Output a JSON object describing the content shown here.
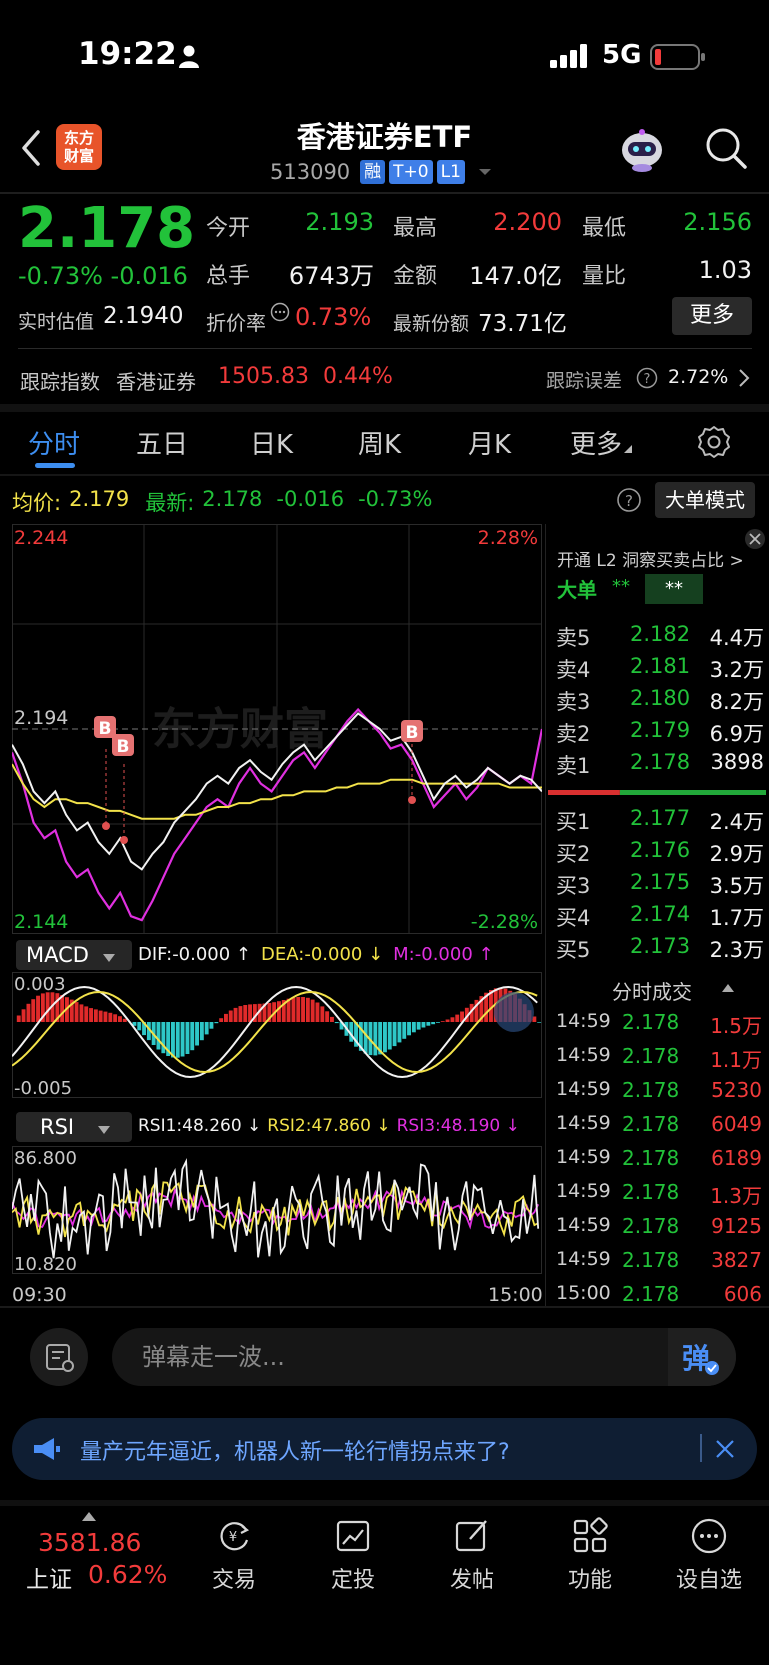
{
  "status": {
    "time": "19:22",
    "network": "5G"
  },
  "header": {
    "title": "香港证券ETF",
    "code": "513090",
    "tags": [
      "融",
      "T+0",
      "L1"
    ],
    "logo_line1": "东方",
    "logo_line2": "财富"
  },
  "quote": {
    "price": "2.178",
    "change_pct": "-0.73%",
    "change": "-0.016",
    "open_label": "今开",
    "open": "2.193",
    "high_label": "最高",
    "high": "2.200",
    "low_label": "最低",
    "low": "2.156",
    "volume_label": "总手",
    "volume": "6743万",
    "amount_label": "金额",
    "amount": "147.0亿",
    "ratio_label": "量比",
    "ratio": "1.03",
    "rt_label": "实时估值",
    "rt_value": "2.1940",
    "discount_label": "折价率",
    "discount": "0.73%",
    "share_label": "最新份额",
    "share": "73.71亿",
    "more_label": "更多"
  },
  "tracking": {
    "label": "跟踪指数",
    "index": "香港证券",
    "value": "1505.83",
    "pct": "0.44%",
    "err_label": "跟踪误差",
    "err": "2.72%"
  },
  "tabs": [
    "分时",
    "五日",
    "日K",
    "周K",
    "月K",
    "更多"
  ],
  "avg_row": {
    "avg_label": "均价:",
    "avg": "2.179",
    "last_label": "最新:",
    "last": "2.178",
    "chg": "-0.016",
    "pct": "-0.73%",
    "bigorder_btn": "大单模式"
  },
  "chart_data": [
    {
      "type": "line",
      "title": "",
      "ylim": [
        2.144,
        2.244
      ],
      "y_ticks": [
        "2.244",
        "2.194",
        "2.144"
      ],
      "pct_ticks": [
        "2.28%",
        "-2.28%"
      ],
      "x_ticks": [
        "09:30",
        "15:00"
      ],
      "series": [
        {
          "values": [
            2.19,
            2.185,
            2.178,
            2.175,
            2.178,
            2.172,
            2.168,
            2.17,
            2.165,
            2.162,
            2.166,
            2.16,
            2.158,
            2.162,
            2.165,
            2.17,
            2.173,
            2.176,
            2.18,
            2.182,
            2.18,
            2.184,
            2.186,
            2.183,
            2.181,
            2.185,
            2.188,
            2.19,
            2.186,
            2.189,
            2.192,
            2.195,
            2.198,
            2.196,
            2.194,
            2.191,
            2.192,
            2.188,
            2.182,
            2.176,
            2.18,
            2.182,
            2.179,
            2.181,
            2.184,
            2.182,
            2.18,
            2.182,
            2.181,
            2.178
          ]
        },
        {
          "values": [
            2.185,
            2.18,
            2.176,
            2.174,
            2.176,
            2.176,
            2.175,
            2.175,
            2.174,
            2.173,
            2.173,
            2.172,
            2.171,
            2.171,
            2.171,
            2.171,
            2.172,
            2.172,
            2.173,
            2.174,
            2.174,
            2.175,
            2.175,
            2.176,
            2.176,
            2.177,
            2.177,
            2.178,
            2.178,
            2.178,
            2.179,
            2.179,
            2.18,
            2.18,
            2.18,
            2.181,
            2.181,
            2.181,
            2.18,
            2.18,
            2.18,
            2.18,
            2.18,
            2.18,
            2.18,
            2.18,
            2.179,
            2.179,
            2.179,
            2.179
          ]
        },
        {
          "values": [
            2.188,
            2.18,
            2.17,
            2.166,
            2.168,
            2.16,
            2.156,
            2.158,
            2.152,
            2.148,
            2.152,
            2.146,
            2.145,
            2.15,
            2.156,
            2.162,
            2.166,
            2.17,
            2.174,
            2.176,
            2.174,
            2.18,
            2.184,
            2.18,
            2.178,
            2.182,
            2.186,
            2.188,
            2.184,
            2.188,
            2.192,
            2.196,
            2.199,
            2.196,
            2.193,
            2.189,
            2.19,
            2.186,
            2.18,
            2.174,
            2.177,
            2.18,
            2.176,
            2.179,
            2.184,
            2.182,
            2.18,
            2.182,
            2.18,
            2.194
          ]
        }
      ]
    },
    {
      "type": "bar",
      "title": "MACD",
      "ylim": [
        -0.005,
        0.003
      ],
      "y_ticks": [
        "0.003",
        "-0.005"
      ],
      "labels": {
        "dif": "DIF:-0.000 ↑",
        "dea": "DEA:-0.000 ↓",
        "m": "M:-0.000 ↑"
      }
    },
    {
      "type": "line",
      "title": "RSI",
      "ylim": [
        10.82,
        86.8
      ],
      "y_ticks": [
        "86.800",
        "10.820"
      ],
      "labels": {
        "rsi1": "RSI1:48.260 ↓",
        "rsi2": "RSI2:47.860 ↓",
        "rsi3": "RSI3:48.190 ↓"
      }
    }
  ],
  "l2": {
    "label": "开通 L2 洞察买卖占比 >",
    "big": "大单",
    "mask_a": "**",
    "mask_b": "**"
  },
  "orderbook": {
    "asks": [
      {
        "label": "卖5",
        "price": "2.182",
        "vol": "4.4万"
      },
      {
        "label": "卖4",
        "price": "2.181",
        "vol": "3.2万"
      },
      {
        "label": "卖3",
        "price": "2.180",
        "vol": "8.2万"
      },
      {
        "label": "卖2",
        "price": "2.179",
        "vol": "6.9万"
      },
      {
        "label": "卖1",
        "price": "2.178",
        "vol": "3898"
      }
    ],
    "bids": [
      {
        "label": "买1",
        "price": "2.177",
        "vol": "2.4万"
      },
      {
        "label": "买2",
        "price": "2.176",
        "vol": "2.9万"
      },
      {
        "label": "买3",
        "price": "2.175",
        "vol": "3.5万"
      },
      {
        "label": "买4",
        "price": "2.174",
        "vol": "1.7万"
      },
      {
        "label": "买5",
        "price": "2.173",
        "vol": "2.3万"
      }
    ],
    "ask_ratio": 0.33
  },
  "ticks": {
    "title": "分时成交",
    "rows": [
      {
        "time": "14:59",
        "price": "2.178",
        "vol": "1.5万"
      },
      {
        "time": "14:59",
        "price": "2.178",
        "vol": "1.1万"
      },
      {
        "time": "14:59",
        "price": "2.178",
        "vol": "5230"
      },
      {
        "time": "14:59",
        "price": "2.178",
        "vol": "6049"
      },
      {
        "time": "14:59",
        "price": "2.178",
        "vol": "6189"
      },
      {
        "time": "14:59",
        "price": "2.178",
        "vol": "1.3万"
      },
      {
        "time": "14:59",
        "price": "2.178",
        "vol": "9125"
      },
      {
        "time": "14:59",
        "price": "2.178",
        "vol": "3827"
      },
      {
        "time": "15:00",
        "price": "2.178",
        "vol": "606"
      }
    ]
  },
  "danmaku": {
    "placeholder": "弹幕走一波...",
    "send": "弹"
  },
  "banner": {
    "text": "量产元年逼近，机器人新一轮行情拐点来了?"
  },
  "bottom": {
    "index_value": "3581.86",
    "index_name": "上证",
    "index_pct": "0.62%",
    "nav": [
      "交易",
      "定投",
      "发帖",
      "功能",
      "设自选"
    ]
  },
  "colors": {
    "up": "#f23b3b",
    "down": "#22c23a",
    "accent": "#3d8ef0",
    "avg_line": "#f2e24a",
    "rsi3": "#e030e0"
  }
}
